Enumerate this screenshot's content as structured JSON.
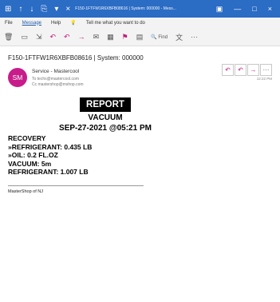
{
  "window": {
    "title": "F150-1FTFW1R6XBFB08616 | System: 000000 - Mess...",
    "quick_access": [
      "⊞",
      "↑",
      "↓",
      "⎘",
      "▾",
      "×"
    ],
    "window_buttons": [
      "▣",
      "—",
      "□",
      "×"
    ]
  },
  "menu": {
    "file": "File",
    "message": "Message",
    "help": "Help",
    "tell_me": "Tell me what you want to do"
  },
  "ribbon": {
    "find": "Find",
    "more": "···"
  },
  "email": {
    "subject": "F150-1FTFW1R6XBFB08616 | System: 000000",
    "avatar_initials": "SM",
    "sender": "Service - Mastercool",
    "to": "To  techs@mastercool.com",
    "cc": "Cc  mastershop@mshop.com",
    "time": "12:22 PM",
    "actions": [
      "↶",
      "↶",
      "→",
      "···"
    ]
  },
  "report": {
    "title": "REPORT",
    "subtitle": "VACUUM",
    "datetime": "SEP-27-2021 @05:21 PM",
    "lines": [
      "RECOVERY",
      "»REFRIGERANT: 0.435 LB",
      "»OIL: 0.2 FL.OZ",
      "VACUUM: 5m",
      "REFRIGERANT: 1.007 LB"
    ],
    "signature": "MasterShop of NJ"
  },
  "colors": {
    "titlebar": "#2b6cc4",
    "avatar": "#c81c8a",
    "accent_pink": "#c21a7c"
  }
}
